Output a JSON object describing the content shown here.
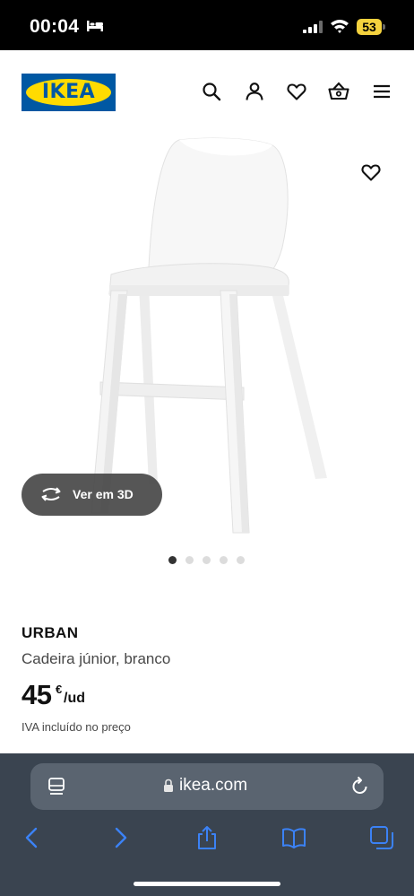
{
  "status_bar": {
    "time": "00:04",
    "battery": "53",
    "icons": [
      "bed-icon",
      "signal-icon",
      "wifi-icon",
      "battery-icon"
    ]
  },
  "header": {
    "logo_text": "IKEA",
    "icons": [
      "search-icon",
      "account-icon",
      "wishlist-icon",
      "cart-icon",
      "menu-icon"
    ],
    "colors": {
      "logo_blue": "#0058a3",
      "logo_yellow": "#ffdb00"
    }
  },
  "gallery": {
    "favorite_icon": "heart-outline-icon",
    "view_3d_label": "Ver em 3D",
    "view_3d_icon": "rotate-3d-icon",
    "dot_count": 5,
    "active_dot": 0
  },
  "product": {
    "name": "URBAN",
    "description": "Cadeira júnior, branco",
    "price": "45",
    "currency": "€",
    "unit": "/ud",
    "vat_note": "IVA incluído no preço"
  },
  "browser": {
    "url": "ikea.com",
    "icons": [
      "tabs-overview-icon",
      "lock-icon",
      "reload-icon",
      "back-icon",
      "forward-icon",
      "share-icon",
      "bookmarks-icon",
      "tabs-icon"
    ],
    "colors": {
      "toolbar": "#3a4450",
      "accent": "#3b82f6"
    }
  }
}
